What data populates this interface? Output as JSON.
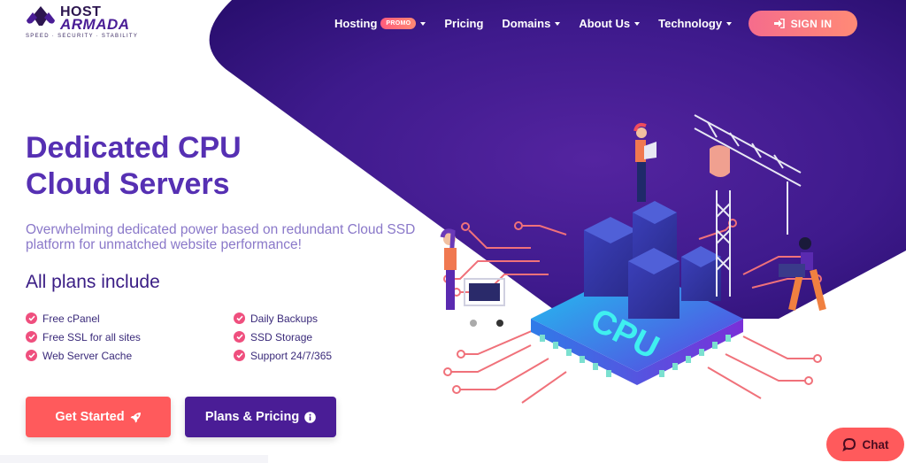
{
  "brand": {
    "name_line1": "HOST",
    "name_line2": "ARMADA",
    "tagline": "SPEED · SECURITY · STABILITY",
    "colors": {
      "primary_purple": "#4a1d96",
      "hero_purple": "#3b1a8a",
      "headline_purple": "#5630b3",
      "coral": "#ff5a5c",
      "pink_check": "#ef4f7e"
    }
  },
  "nav": {
    "items": [
      {
        "label": "Hosting",
        "badge": "PROMO",
        "has_dropdown": true
      },
      {
        "label": "Pricing",
        "has_dropdown": false
      },
      {
        "label": "Domains",
        "has_dropdown": true
      },
      {
        "label": "About Us",
        "has_dropdown": true
      },
      {
        "label": "Technology",
        "has_dropdown": true
      }
    ],
    "signin_label": "SIGN IN",
    "signin_icon": "sign-in-icon"
  },
  "hero": {
    "title_line1": "Dedicated CPU",
    "title_line2": "Cloud Servers",
    "subtitle": "Overwhelming dedicated power based on redundant Cloud SSD platform for unmatched website performance!",
    "includes_title": "All plans include",
    "features": [
      "Free cPanel",
      "Daily Backups",
      "Free SSL for all sites",
      "SSD Storage",
      "Web Server Cache",
      "Support 24/7/365"
    ],
    "feature_icon": "check-circle-icon",
    "cta_primary": {
      "label": "Get Started",
      "icon": "rocket-icon"
    },
    "cta_secondary": {
      "label": "Plans & Pricing",
      "icon": "info-circle-icon"
    },
    "illustration": {
      "chip_label": "CPU",
      "description": "isometric CPU chip with server racks, crane, people and circuit traces"
    }
  },
  "chat": {
    "label": "Chat",
    "icon": "chat-bubble-icon"
  }
}
